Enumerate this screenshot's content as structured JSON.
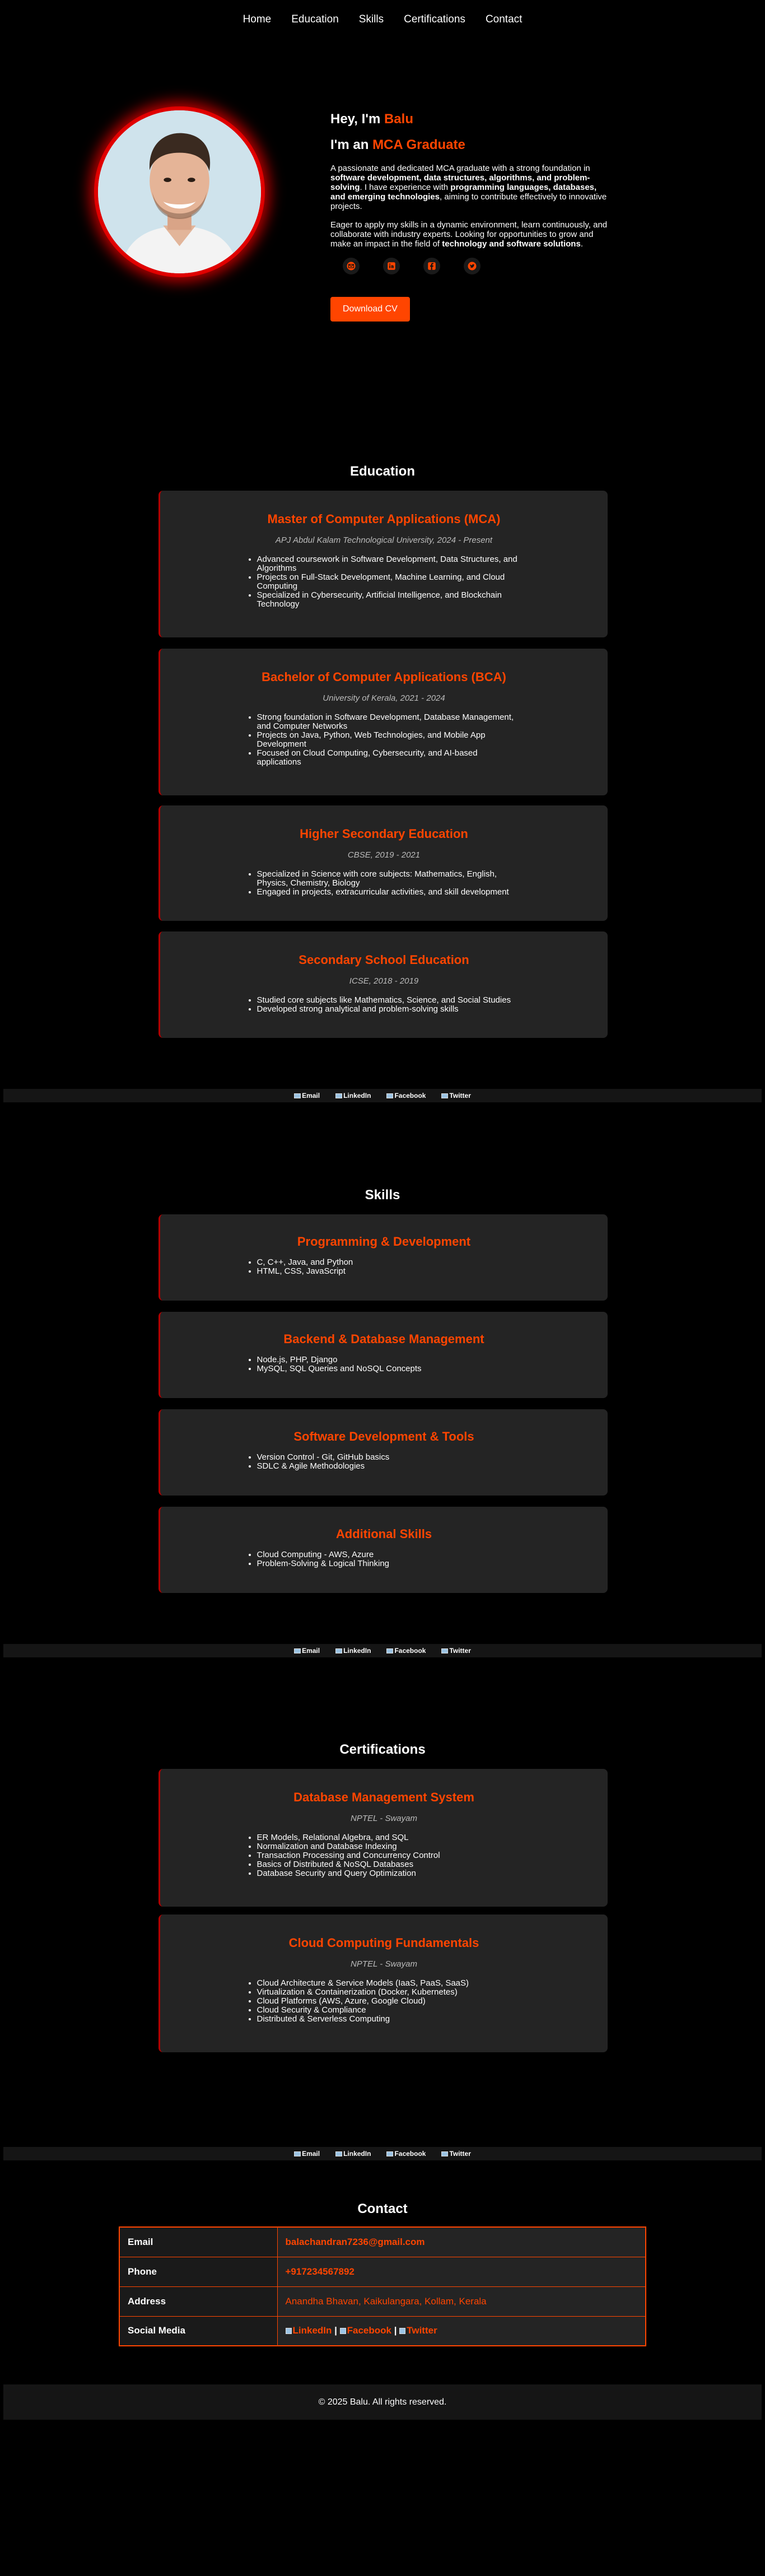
{
  "nav": {
    "items": [
      "Home",
      "Education",
      "Skills",
      "Certifications",
      "Contact"
    ]
  },
  "hero": {
    "greeting_prefix": "Hey, I'm ",
    "name": "Balu",
    "role_prefix": "I'm an ",
    "role": "MCA Graduate",
    "p1": [
      {
        "t": "A passionate and dedicated MCA graduate with a strong foundation in ",
        "b": false
      },
      {
        "t": "software development, data structures, algorithms, and problem-solving",
        "b": true
      },
      {
        "t": ". I have experience with ",
        "b": false
      },
      {
        "t": "programming languages, databases, and emerging technologies",
        "b": true
      },
      {
        "t": ", aiming to contribute effectively to innovative projects.",
        "b": false
      }
    ],
    "p2": [
      {
        "t": "Eager to apply my skills in a dynamic environment, learn continuously, and collaborate with industry experts. Looking for opportunities to grow and make an impact in the field of ",
        "b": false
      },
      {
        "t": "technology and software solutions",
        "b": true
      },
      {
        "t": ".",
        "b": false
      }
    ],
    "socials": [
      "email-icon",
      "linkedin-icon",
      "facebook-icon",
      "twitter-icon"
    ],
    "cv_button": "Download CV"
  },
  "education": {
    "title": "Education",
    "cards": [
      {
        "title": "Master of Computer Applications (MCA)",
        "sub": "APJ Abdul Kalam Technological University, 2024 - Present",
        "items": [
          "Advanced coursework in Software Development, Data Structures, and Algorithms",
          "Projects on Full-Stack Development, Machine Learning, and Cloud Computing",
          "Specialized in Cybersecurity, Artificial Intelligence, and Blockchain Technology"
        ]
      },
      {
        "title": "Bachelor of Computer Applications (BCA)",
        "sub": "University of Kerala, 2021 - 2024",
        "items": [
          "Strong foundation in Software Development, Database Management, and Computer Networks",
          "Projects on Java, Python, Web Technologies, and Mobile App Development",
          "Focused on Cloud Computing, Cybersecurity, and AI-based applications"
        ]
      },
      {
        "title": "Higher Secondary Education",
        "sub": "CBSE, 2019 - 2021",
        "items": [
          "Specialized in Science with core subjects: Mathematics, English, Physics, Chemistry, Biology",
          "Engaged in projects, extracurricular activities, and skill development"
        ]
      },
      {
        "title": "Secondary School Education",
        "sub": "ICSE, 2018 - 2019",
        "items": [
          "Studied core subjects like Mathematics, Science, and Social Studies",
          "Developed strong analytical and problem-solving skills"
        ]
      }
    ]
  },
  "strip": {
    "items": [
      "Email",
      "LinkedIn",
      "Facebook",
      "Twitter"
    ]
  },
  "skills": {
    "title": "Skills",
    "cards": [
      {
        "title": "Programming & Development",
        "items": [
          "C, C++, Java, and Python",
          "HTML, CSS, JavaScript"
        ]
      },
      {
        "title": "Backend & Database Management",
        "items": [
          "Node.js, PHP, Django",
          "MySQL, SQL Queries and NoSQL Concepts"
        ]
      },
      {
        "title": "Software Development & Tools",
        "items": [
          "Version Control - Git, GitHub basics",
          "SDLC & Agile Methodologies"
        ]
      },
      {
        "title": "Additional Skills",
        "items": [
          "Cloud Computing - AWS, Azure",
          "Problem-Solving & Logical Thinking"
        ]
      }
    ]
  },
  "certifications": {
    "title": "Certifications",
    "cards": [
      {
        "title": "Database Management System",
        "sub": "NPTEL - Swayam",
        "items": [
          "ER Models, Relational Algebra, and SQL",
          "Normalization and Database Indexing",
          "Transaction Processing and Concurrency Control",
          "Basics of Distributed & NoSQL Databases",
          "Database Security and Query Optimization"
        ]
      },
      {
        "title": "Cloud Computing Fundamentals",
        "sub": "NPTEL - Swayam",
        "items": [
          "Cloud Architecture & Service Models (IaaS, PaaS, SaaS)",
          "Virtualization & Containerization (Docker, Kubernetes)",
          "Cloud Platforms (AWS, Azure, Google Cloud)",
          "Cloud Security & Compliance",
          "Distributed & Serverless Computing"
        ]
      }
    ]
  },
  "contact": {
    "title": "Contact",
    "rows": [
      {
        "label": "Email",
        "value": "balachandran7236@gmail.com"
      },
      {
        "label": "Phone",
        "value": "+917234567892"
      },
      {
        "label": "Address",
        "value": "Anandha Bhavan, Kaikulangara, Kollam, Kerala"
      }
    ],
    "social_label": "Social Media",
    "social_links": [
      "LinkedIn",
      "Facebook",
      "Twitter"
    ],
    "separator": "|"
  },
  "footer": {
    "text": "© 2025 Balu. All rights reserved."
  },
  "colors": {
    "accent": "#ff4500",
    "glow": "#e00000",
    "card": "#242424",
    "bg": "#000000"
  }
}
